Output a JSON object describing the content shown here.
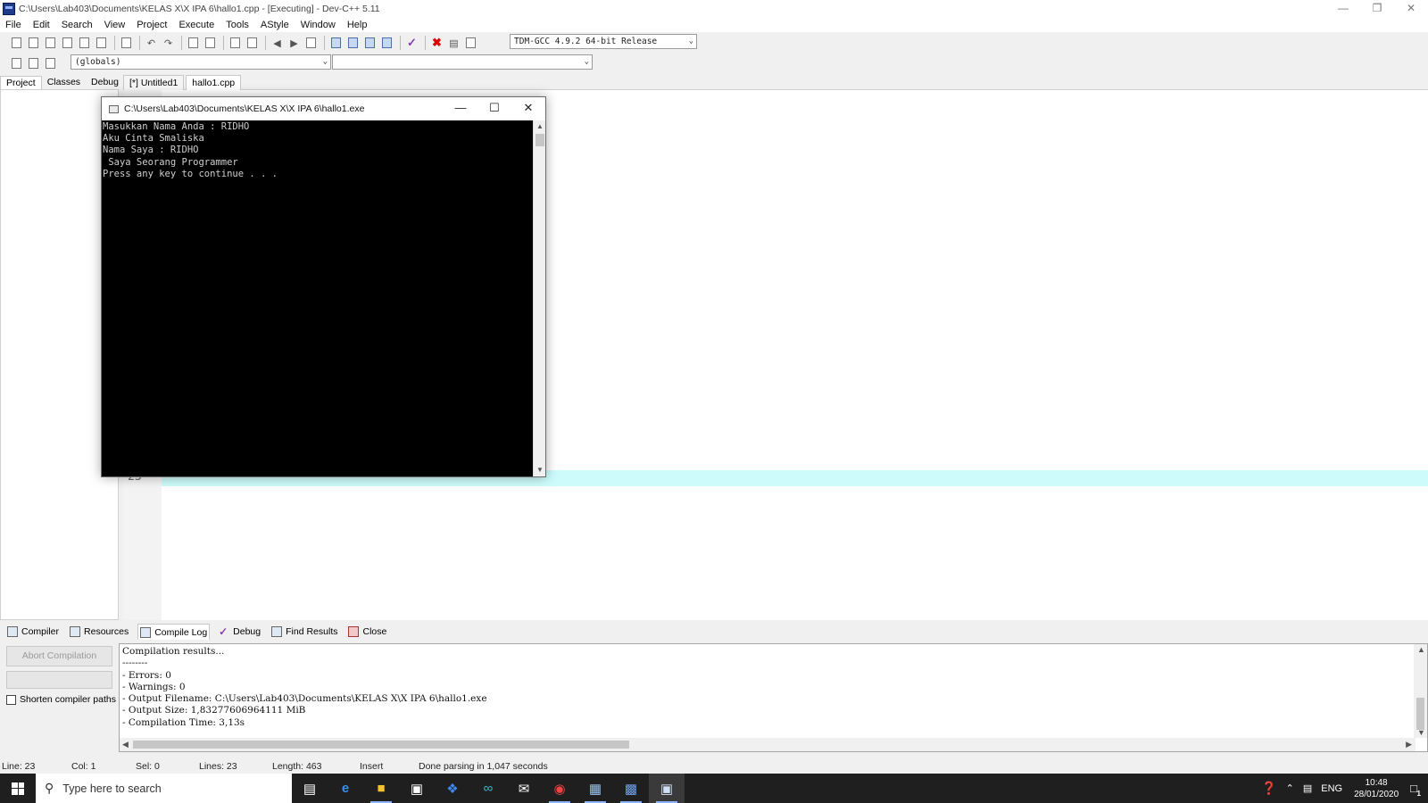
{
  "window": {
    "title": "C:\\Users\\Lab403\\Documents\\KELAS X\\X IPA 6\\hallo1.cpp - [Executing] - Dev-C++ 5.11"
  },
  "menu": [
    "File",
    "Edit",
    "Search",
    "View",
    "Project",
    "Execute",
    "Tools",
    "AStyle",
    "Window",
    "Help"
  ],
  "toolbar": {
    "compiler_select": "TDM-GCC 4.9.2 64-bit Release"
  },
  "toolbar2": {
    "scope_select": "(globals)",
    "function_select": ""
  },
  "left_tabs": [
    "Project",
    "Classes",
    "Debug"
  ],
  "editor_tabs": [
    "[*] Untitled1",
    "hallo1.cpp"
  ],
  "editor": {
    "current_line_number": "23"
  },
  "console": {
    "title": "C:\\Users\\Lab403\\Documents\\KELAS X\\X IPA 6\\hallo1.exe",
    "output": "Masukkan Nama Anda : RIDHO\nAku Cinta Smaliska\nNama Saya : RIDHO\n Saya Seorang Programmer\nPress any key to continue . . ."
  },
  "bottom_tabs": [
    "Compiler",
    "Resources",
    "Compile Log",
    "Debug",
    "Find Results",
    "Close"
  ],
  "bottom": {
    "abort_label": "Abort Compilation",
    "shorten_paths_label": "Shorten compiler paths",
    "log": "Compilation results...\n--------\n- Errors: 0\n- Warnings: 0\n- Output Filename: C:\\Users\\Lab403\\Documents\\KELAS X\\X IPA 6\\hallo1.exe\n- Output Size: 1,83277606964111 MiB\n- Compilation Time: 3,13s"
  },
  "status": {
    "line": "Line:   23",
    "col": "Col:    1",
    "sel": "Sel:    0",
    "lines": "Lines:   23",
    "length": "Length:   463",
    "mode": "Insert",
    "message": "Done parsing in 1,047 seconds"
  },
  "taskbar": {
    "search_placeholder": "Type here to search",
    "language": "ENG",
    "time": "10:48",
    "date": "28/01/2020",
    "notification_count": "1"
  }
}
